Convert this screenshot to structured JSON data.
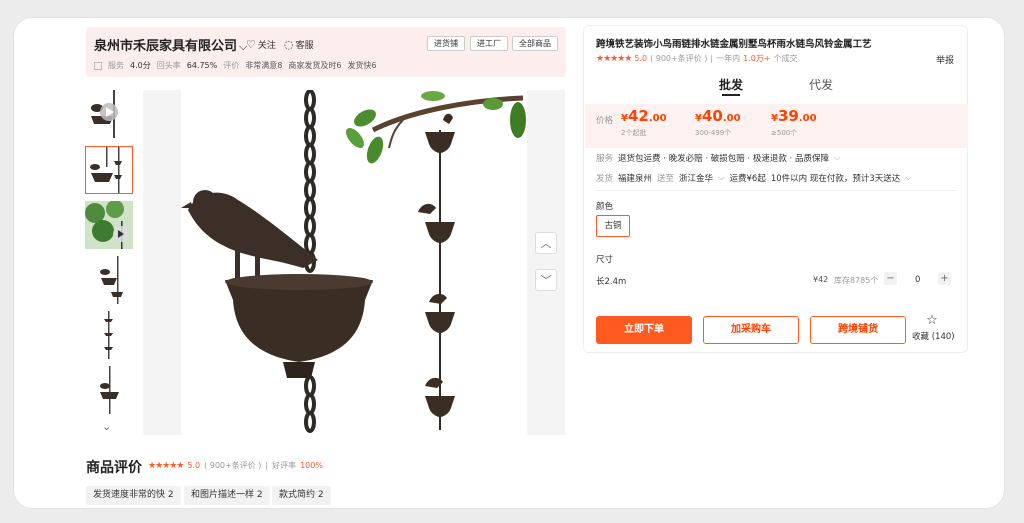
{
  "shop": {
    "name": "泉州市禾辰家具有限公司",
    "follow_label": "关注",
    "report_label": "客服",
    "buttons": [
      "进货铺",
      "进工厂",
      "全部商品"
    ],
    "stats": {
      "service_label": "服务",
      "service_score": "4.0分",
      "repurchase_label": "回头率",
      "repurchase_value": "64.75%",
      "eval_label": "评价",
      "tags": [
        "非常满意8",
        "商家发货及时6",
        "发货快6"
      ]
    }
  },
  "gallery": {
    "thumb_count": 6,
    "active_thumb": 2,
    "up_icon": "chevron-up-icon",
    "down_icon": "chevron-down-icon"
  },
  "reviews": {
    "title": "商品评价",
    "stars": "★★★★★",
    "score": "5.0",
    "count": "( 900+条评价 )",
    "separator": "|",
    "good_label": "好评率",
    "good_rate": "100%",
    "chips": [
      "发货速度非常的快 2",
      "和图片描述一样 2",
      "款式简约 2"
    ]
  },
  "product": {
    "title": "跨境铁艺装饰小鸟雨链排水链金属别墅鸟杯雨水链鸟风铃金属工艺",
    "stars": "★★★★★",
    "score": "5.0",
    "review_count": "( 900+条评价 )",
    "separator": "|",
    "sales_prefix": "一年内",
    "sales_value": "1.0万+",
    "sales_suffix": "个成交",
    "report": "举报",
    "tabs": [
      "批发",
      "代发"
    ],
    "price_label": "价格",
    "prices": [
      {
        "symbol": "¥",
        "int": "42",
        "dec": ".00",
        "note": "2个起批"
      },
      {
        "symbol": "¥",
        "int": "40",
        "dec": ".00",
        "note": "300-499个"
      },
      {
        "symbol": "¥",
        "int": "39",
        "dec": ".00",
        "note": "≥500个"
      }
    ],
    "service_label": "服务",
    "service_items": "退货包运费 · 晚发必赔 · 破损包赔 · 极速退款 · 品质保障",
    "ship_label": "发货",
    "ship_from": "福建泉州",
    "ship_to_label": "送至",
    "ship_to": "浙江金华",
    "ship_fee": "运费¥6起",
    "ship_note": "10件以内  现在付款，预计3天送达",
    "color_label": "颜色",
    "color_value": "古铜",
    "size_label": "尺寸",
    "size_value": "长2.4m",
    "size_price": "¥42",
    "stock": "库存8785个",
    "qty": "0",
    "minus": "−",
    "plus": "+",
    "buttons": {
      "buy": "立即下单",
      "cart": "加采购车",
      "cross": "跨境铺货"
    },
    "fav_label": "收藏",
    "fav_count": "(140)"
  }
}
